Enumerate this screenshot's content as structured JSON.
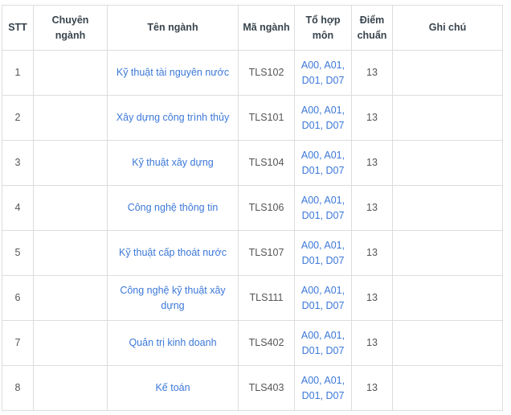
{
  "table": {
    "columns": [
      {
        "key": "stt",
        "label": "STT"
      },
      {
        "key": "chuyen",
        "label": "Chuyên ngành"
      },
      {
        "key": "ten",
        "label": "Tên ngành"
      },
      {
        "key": "ma",
        "label": "Mã ngành"
      },
      {
        "key": "tohop",
        "label": "Tổ hợp môn"
      },
      {
        "key": "diem",
        "label": "Điểm chuẩn"
      },
      {
        "key": "ghichu",
        "label": "Ghi chú"
      }
    ],
    "rows": [
      {
        "stt": "1",
        "chuyen": "",
        "ten": "Kỹ thuật tài nguyên nước",
        "ma": "TLS102",
        "tohop": "A00, A01, D01, D07",
        "diem": "13",
        "ghichu": ""
      },
      {
        "stt": "2",
        "chuyen": "",
        "ten": "Xây dựng công trình thủy",
        "ma": "TLS101",
        "tohop": "A00, A01, D01, D07",
        "diem": "13",
        "ghichu": ""
      },
      {
        "stt": "3",
        "chuyen": "",
        "ten": "Kỹ thuật xây dựng",
        "ma": "TLS104",
        "tohop": "A00, A01, D01, D07",
        "diem": "13",
        "ghichu": ""
      },
      {
        "stt": "4",
        "chuyen": "",
        "ten": "Công nghệ thông tin",
        "ma": "TLS106",
        "tohop": "A00, A01, D01, D07",
        "diem": "13",
        "ghichu": ""
      },
      {
        "stt": "5",
        "chuyen": "",
        "ten": "Kỹ thuật cấp thoát nước",
        "ma": "TLS107",
        "tohop": "A00, A01, D01, D07",
        "diem": "13",
        "ghichu": ""
      },
      {
        "stt": "6",
        "chuyen": "",
        "ten": "Công nghệ kỹ thuật xây dựng",
        "ma": "TLS111",
        "tohop": "A00, A01, D01, D07",
        "diem": "13",
        "ghichu": ""
      },
      {
        "stt": "7",
        "chuyen": "",
        "ten": "Quản trị kinh doanh",
        "ma": "TLS402",
        "tohop": "A00, A01, D01, D07",
        "diem": "13",
        "ghichu": ""
      },
      {
        "stt": "8",
        "chuyen": "",
        "ten": "Kế toán",
        "ma": "TLS403",
        "tohop": "A00, A01, D01, D07",
        "diem": "13",
        "ghichu": ""
      }
    ]
  },
  "colors": {
    "link_blue": "#3c78d8",
    "header_text": "#38444d",
    "body_text": "#555555",
    "border": "#dddddd",
    "background": "#ffffff"
  }
}
